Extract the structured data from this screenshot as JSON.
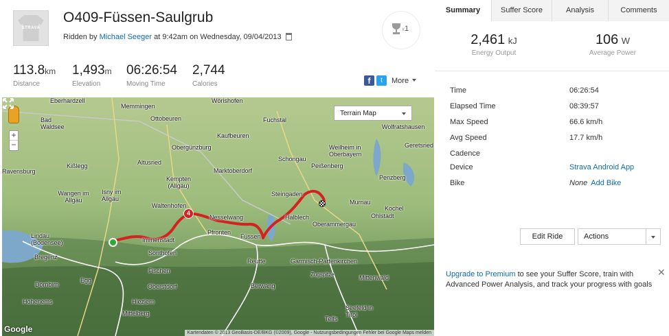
{
  "ride": {
    "title": "O409-Füssen-Saulgrub",
    "ridden_by_prefix": "Ridden by",
    "athlete": "Michael Seeger",
    "ridden_suffix": "at 9:42am on Wednesday, 09/04/2013",
    "avatar_brand": "STRAVA"
  },
  "trophy": {
    "x": "x",
    "count": "1"
  },
  "stats": [
    {
      "value": "113.8",
      "unit": "km",
      "label": "Distance"
    },
    {
      "value": "1,493",
      "unit": "m",
      "label": "Elevation"
    },
    {
      "value": "06:26:54",
      "unit": "",
      "label": "Moving Time"
    },
    {
      "value": "2,744",
      "unit": "",
      "label": "Calories"
    }
  ],
  "share": {
    "fb": "f",
    "tw": "t",
    "more": "More"
  },
  "map": {
    "type_label": "Terrain Map",
    "km_marker": "4",
    "google": "Google",
    "credits": "Kartendaten © 2013 GeoBasis-DE/BKG (©2009), Google - Nutzungsbedingungen   Fehler bei Google Maps melden",
    "zoom_in": "+",
    "zoom_out": "−",
    "places": [
      "Eberhardzell",
      "Memmingen",
      "Wörishofen",
      "Bad Waldsee",
      "Ottobeuren",
      "Fuchstal",
      "Wolfratshausen",
      "Obergünzburg",
      "Kaufbeuren",
      "Weilheim in Oberbayern",
      "Geretsried",
      "Ravensburg",
      "Kißlegg",
      "Altusried",
      "Schongau",
      "Kempten (Allgäu)",
      "Marktoberdorf",
      "Peißenberg",
      "Penzberg",
      "Wangen im Allgäu",
      "Isny im Allgäu",
      "Steingaden",
      "Murnau",
      "Kochel",
      "Waltenhofen",
      "Halblech",
      "Ohlstadt",
      "Nesselwang",
      "Oberammergau",
      "Lindau (Bodensee)",
      "Immenstadt",
      "Pfronten",
      "Füssen",
      "Bregenz",
      "Sonthofen",
      "Reutte",
      "Garmisch-Partenkirchen",
      "Mittenwald",
      "Dornbirn",
      "Fischen",
      "Egg",
      "Oberstdorf",
      "Zugspitze",
      "Berwang",
      "Hohenems",
      "Hiezlern",
      "Seefeld in Tirol",
      "Mittelberg",
      "Telfs"
    ]
  },
  "tabs": [
    "Summary",
    "Suffer Score",
    "Analysis",
    "Comments"
  ],
  "energy": [
    {
      "value": "2,461",
      "unit": "kJ",
      "label": "Energy Output"
    },
    {
      "value": "106",
      "unit": "W",
      "label": "Average Power"
    }
  ],
  "details": [
    {
      "key": "Time",
      "value": "06:26:54"
    },
    {
      "key": "Elapsed Time",
      "value": "08:39:57"
    },
    {
      "key": "Max Speed",
      "value": "66.6 km/h"
    },
    {
      "key": "Avg Speed",
      "value": "17.7 km/h"
    },
    {
      "key": "Cadence",
      "value": ""
    },
    {
      "key": "Device",
      "value": "Strava Android App"
    },
    {
      "key": "Bike",
      "value": "None",
      "extra": "Add Bike"
    }
  ],
  "buttons": {
    "edit": "Edit Ride",
    "actions": "Actions"
  },
  "promo": {
    "link": "Upgrade to Premium",
    "text": "to see your Suffer Score, train with Advanced Power Analysis, and track your progress with goals",
    "close": "✕"
  }
}
